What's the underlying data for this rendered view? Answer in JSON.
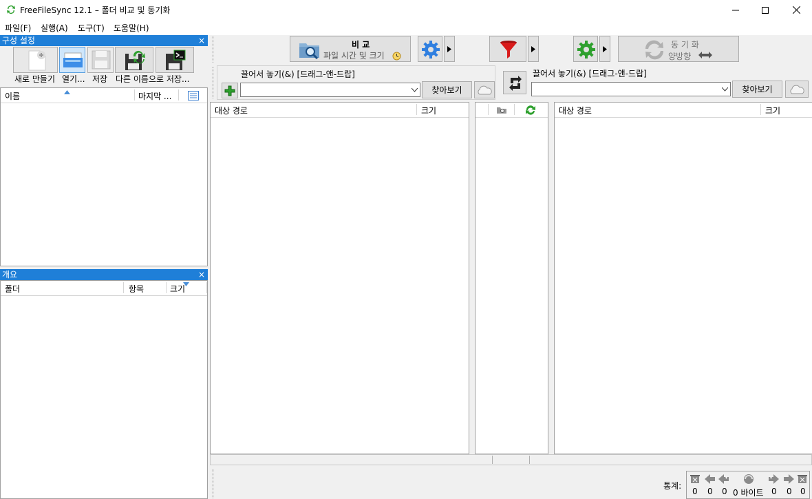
{
  "window": {
    "title": "FreeFileSync 12.1 – 폴더 비교 및 동기화",
    "minimize": "—",
    "maximize": "☐",
    "close": "✕"
  },
  "menu": [
    "파일(F)",
    "실행(A)",
    "도구(T)",
    "도움말(H)"
  ],
  "config_panel": {
    "title": "구성 설정",
    "close": "×",
    "buttons": {
      "new": "새로 만들기",
      "open": "열기...",
      "save": "저장",
      "save_as": "다른 이름으로 저장..."
    },
    "columns": {
      "name": "이름",
      "last": "마지막 ..."
    }
  },
  "overview_panel": {
    "title": "개요",
    "close": "×",
    "columns": {
      "folder": "폴더",
      "items": "항목",
      "size": "크기"
    }
  },
  "toolbar": {
    "compare_title": "비 교",
    "compare_sub": "파일 시간 및 크기",
    "sync_title": "동 기 화",
    "sync_sub": "양방향"
  },
  "left_folder": {
    "drop_label": "끌어서 놓기(&) [드래그-앤-드랍]",
    "path": "",
    "browse": "찾아보기"
  },
  "right_folder": {
    "drop_label": "끌어서 놓기(&) [드래그-앤-드랍]",
    "path": "",
    "browse": "찾아보기"
  },
  "grid_left": {
    "path_col": "대상 경로",
    "size_col": "크기"
  },
  "grid_right": {
    "path_col": "대상 경로",
    "size_col": "크기"
  },
  "status": {
    "label": "통계:",
    "counts": [
      "0",
      "0",
      "0",
      "0 바이트",
      "0",
      "0",
      "0"
    ]
  },
  "colors": {
    "accent": "#1f7fd8",
    "filter": "#d81b1b",
    "gear_blue": "#2f7fe0",
    "gear_green": "#2ea02e"
  }
}
